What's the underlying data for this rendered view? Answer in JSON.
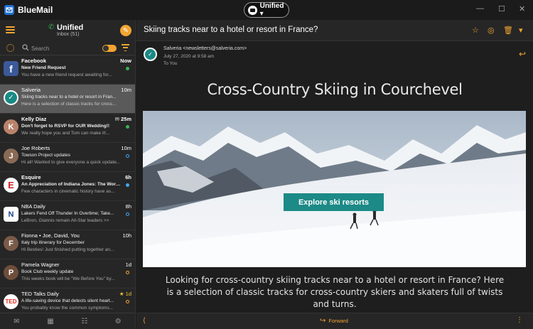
{
  "app": {
    "name": "BlueMail"
  },
  "account_switcher": {
    "label": "Unified ▾"
  },
  "window_controls": {
    "minimize": "—",
    "maximize": "☐",
    "close": "✕"
  },
  "sidebar": {
    "title": "Unified",
    "subtitle": "Inbox (51)",
    "search_placeholder": "Search",
    "compose_glyph": "✎",
    "bottom_icons": [
      "✉",
      "▦",
      "☷",
      "⚙"
    ]
  },
  "mail_list": [
    {
      "sender": "Facebook",
      "time": "Now",
      "subject": "New Friend Request",
      "preview": "You have a new friend request awaiting for...",
      "avatar_text": "f",
      "avatar_color": "#3b5998",
      "indicator": "green"
    },
    {
      "sender": "Salveria",
      "time": "10m",
      "subject": "Skiing tracks near to a hotel or resort in Fran...",
      "preview": "Here is a selection of classic tracks for cross...",
      "avatar_text": "✓",
      "avatar_color": "#1a8a85",
      "indicator": "none"
    },
    {
      "sender": "Kelly Diaz",
      "time": "✉ 25m",
      "subject": "Don't forget to RSVP for OUR Wedding!!",
      "preview": "We really hope you and Tom can make it!...",
      "avatar_text": "K",
      "avatar_color": "#b9826c",
      "indicator": "green"
    },
    {
      "sender": "Joe Roberts",
      "time": "10m",
      "subject": "Towson Project updates",
      "preview": "Hi all! Wanted to give everyone a quick update...",
      "avatar_text": "J",
      "avatar_color": "#8a6a55",
      "indicator": "ring"
    },
    {
      "sender": "Esquire",
      "time": "6h",
      "subject": "An Appreciation of Indiana Jones: The Worl...",
      "preview": "Few characters in cinematic history have as...",
      "avatar_text": "E",
      "avatar_color": "#d0242b",
      "indicator": "blue"
    },
    {
      "sender": "NBA Daily",
      "time": "8h",
      "subject": "Lakers Fend Off Thunder In Overtime; Take...",
      "preview": "LeBron, Giannis remain All-Star leaders >>",
      "avatar_text": "N",
      "avatar_color": "#1d428a",
      "indicator": "ring"
    },
    {
      "sender": "Fionna • Joe, David, You",
      "time": "10h",
      "subject": "Italy trip itinerary for December",
      "preview": "Hi Besties! Just finished putting together an...",
      "avatar_text": "F",
      "avatar_color": "#7a5a48",
      "indicator": "none"
    },
    {
      "sender": "Pamela Wagner",
      "time": "1d",
      "subject": "Book Club weekly update",
      "preview": "This weeks book will be \"We Before You\" by...",
      "avatar_text": "P",
      "avatar_color": "#6e4e3a",
      "indicator": "ring-o"
    },
    {
      "sender": "TED Talks Daily",
      "time": "★ 1d",
      "subject": "A life-saving device that detects silent heart...",
      "preview": "You probably know the common symptoms...",
      "avatar_text": "TED",
      "avatar_color": "#e62b1e",
      "indicator": "ring-o"
    }
  ],
  "message": {
    "subject": "Skiing tracks near to a hotel or resort in France?",
    "from": "Salveria <newsletters@salveria.com>",
    "date": "July 27, 2020 at 9:58 am",
    "to": "To You",
    "header_icons": [
      "☆",
      "◎",
      "🗑",
      "▾"
    ],
    "reply_glyph": "↩"
  },
  "email": {
    "title": "Cross-Country Skiing in Courchevel",
    "cta_label": "Explore ski resorts",
    "body": "Looking for cross-country skiing tracks near to a hotel or resort in France? Here is a selection of classic tracks for cross-country skiers and skaters full of twists and turns."
  },
  "footer": {
    "forward_label": "Forward",
    "share_glyph": "⟨",
    "more_glyph": "⋮"
  },
  "colors": {
    "accent": "#f2a531",
    "teal": "#1c8a87",
    "selected_row": "#5a5a5a"
  }
}
